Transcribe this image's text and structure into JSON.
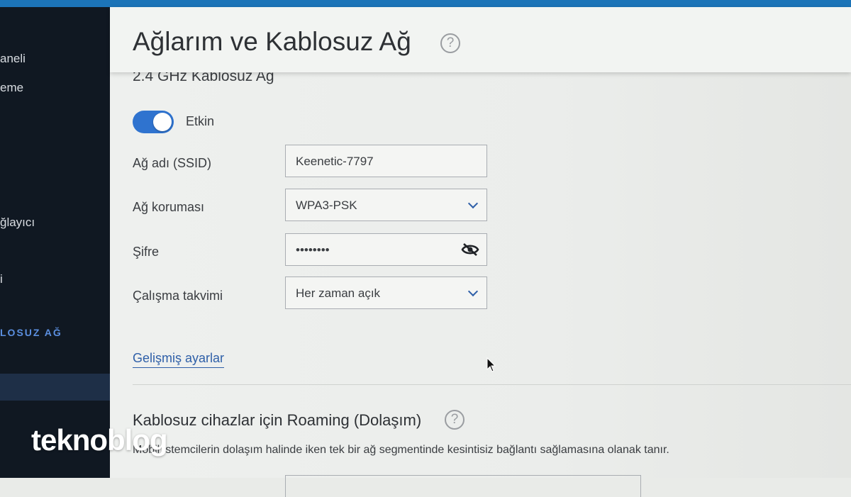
{
  "header": {
    "title": "Ağlarım ve Kablosuz Ağ",
    "help_glyph": "?"
  },
  "sidebar": {
    "items": [
      "aneli",
      "eme",
      "ğlayıcı",
      "i",
      "LOSUZ AĞ"
    ]
  },
  "section": {
    "title_partial": "2.4 GHz Kablosuz Ağ"
  },
  "toggle": {
    "label": "Etkin",
    "state": "on"
  },
  "fields": {
    "ssid": {
      "label": "Ağ adı (SSID)",
      "value": "Keenetic-7797"
    },
    "security": {
      "label": "Ağ koruması",
      "value": "WPA3-PSK"
    },
    "password": {
      "label": "Şifre",
      "value": "••••••••",
      "icon": "eye-slash-icon"
    },
    "schedule": {
      "label": "Çalışma takvimi",
      "value": "Her zaman açık"
    }
  },
  "advanced_link": "Gelişmiş ayarlar",
  "roaming": {
    "title": "Kablosuz cihazlar için Roaming (Dolaşım)",
    "help_glyph": "?",
    "description": "Mobil istemcilerin dolaşım halinde iken tek bir ağ segmentinde kesintisiz bağlantı sağlamasına olanak tanır."
  },
  "watermark": "teknoblog",
  "colors": {
    "accent": "#2f73cf",
    "link": "#2e5fa8",
    "sidebar_bg": "#101822",
    "sidebar_active": "#5b8fe0"
  }
}
